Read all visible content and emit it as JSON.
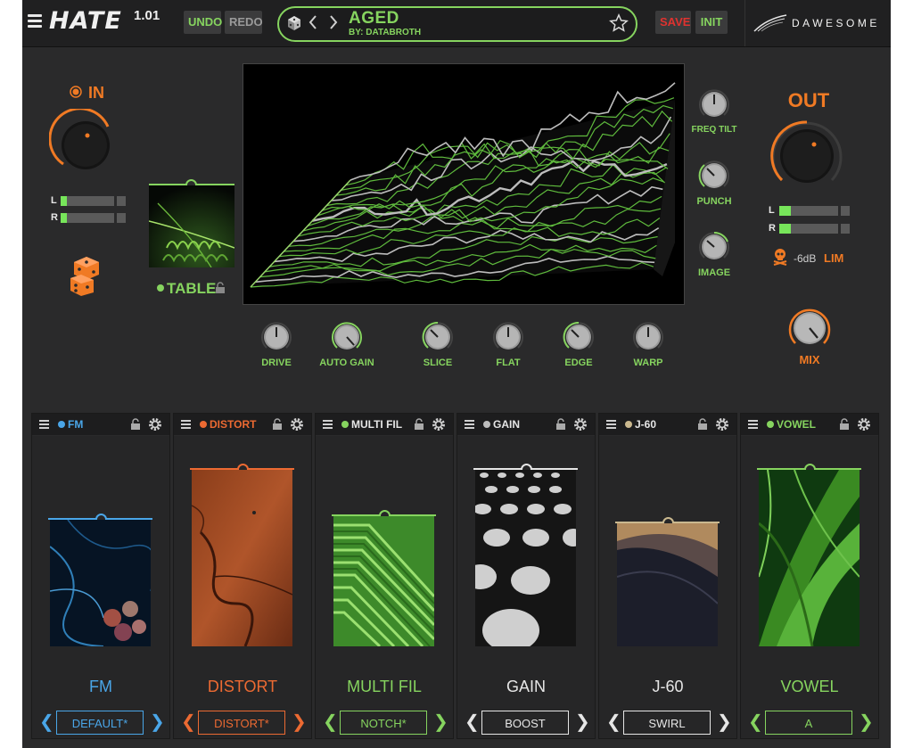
{
  "app": {
    "name": "HATE",
    "version": "1.01",
    "brand": "DAWESOME"
  },
  "toolbar": {
    "undo": "UNDO",
    "redo": "REDO",
    "save": "SAVE",
    "init": "INIT"
  },
  "preset": {
    "name": "AGED",
    "author": "BY: DATABROTH"
  },
  "input": {
    "label": "IN",
    "meter_l_label": "L",
    "meter_r_label": "R",
    "level_l": 0.12,
    "level_r": 0.12
  },
  "output": {
    "label": "OUT",
    "meter_l_label": "L",
    "meter_r_label": "R",
    "limiter_db": "-6dB",
    "limiter_label": "LIM",
    "mix_label": "MIX",
    "level_l": 0.2,
    "level_r": 0.2
  },
  "table": {
    "label": "TABLE"
  },
  "side_knobs": [
    {
      "label": "FREQ TILT"
    },
    {
      "label": "PUNCH"
    },
    {
      "label": "IMAGE"
    }
  ],
  "bottom_knobs": [
    {
      "label": "DRIVE"
    },
    {
      "label": "AUTO GAIN"
    },
    {
      "label": "SLICE"
    },
    {
      "label": "FLAT"
    },
    {
      "label": "EDGE"
    },
    {
      "label": "WARP"
    }
  ],
  "slots": [
    {
      "header": "FM",
      "title": "FM",
      "preset": "DEFAULT*",
      "color": "#4aa6e8"
    },
    {
      "header": "DISTORT",
      "title": "DISTORT",
      "preset": "DISTORT*",
      "color": "#ec6a32"
    },
    {
      "header": "MULTI FIL",
      "title": "MULTI FIL",
      "preset": "NOTCH*",
      "color": "#86d45f"
    },
    {
      "header": "GAIN",
      "title": "GAIN",
      "preset": "BOOST",
      "color": "#e6e6e6"
    },
    {
      "header": "J-60",
      "title": "J-60",
      "preset": "SWIRL",
      "color": "#e6e6e6"
    },
    {
      "header": "VOWEL",
      "title": "VOWEL",
      "preset": "A",
      "color": "#86d45f"
    }
  ],
  "colors": {
    "accent_green": "#86d45f",
    "accent_orange": "#f07a24",
    "save_red": "#e0322f",
    "meter_green": "#77e55a"
  }
}
